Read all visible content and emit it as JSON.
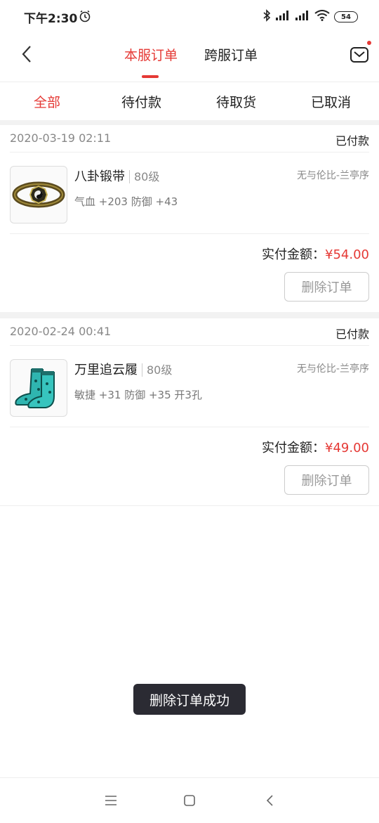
{
  "status_bar": {
    "time": "下午2:30",
    "battery": "54"
  },
  "header": {
    "tabs": [
      {
        "label": "本服订单",
        "active": true
      },
      {
        "label": "跨服订单",
        "active": false
      }
    ],
    "has_unread": true
  },
  "filters": [
    {
      "label": "全部",
      "active": true
    },
    {
      "label": "待付款",
      "active": false
    },
    {
      "label": "待取货",
      "active": false
    },
    {
      "label": "已取消",
      "active": false
    }
  ],
  "orders": [
    {
      "date": "2020-03-19 02:11",
      "status": "已付款",
      "item_name": "八卦锻带",
      "item_level": "80级",
      "server": "无与伦比-兰亭序",
      "attributes": "气血 +203 防御 +43",
      "paid_label": "实付金额：",
      "paid_amount": "¥54.00",
      "delete_label": "删除订单",
      "icon": "belt-icon"
    },
    {
      "date": "2020-02-24 00:41",
      "status": "已付款",
      "item_name": "万里追云履",
      "item_level": "80级",
      "server": "无与伦比-兰亭序",
      "attributes": "敏捷 +31 防御 +35 开3孔",
      "paid_label": "实付金额：",
      "paid_amount": "¥49.00",
      "delete_label": "删除订单",
      "icon": "boots-icon"
    }
  ],
  "toast": "删除订单成功",
  "colors": {
    "accent": "#e53935",
    "toast_bg": "#2b2b33"
  }
}
